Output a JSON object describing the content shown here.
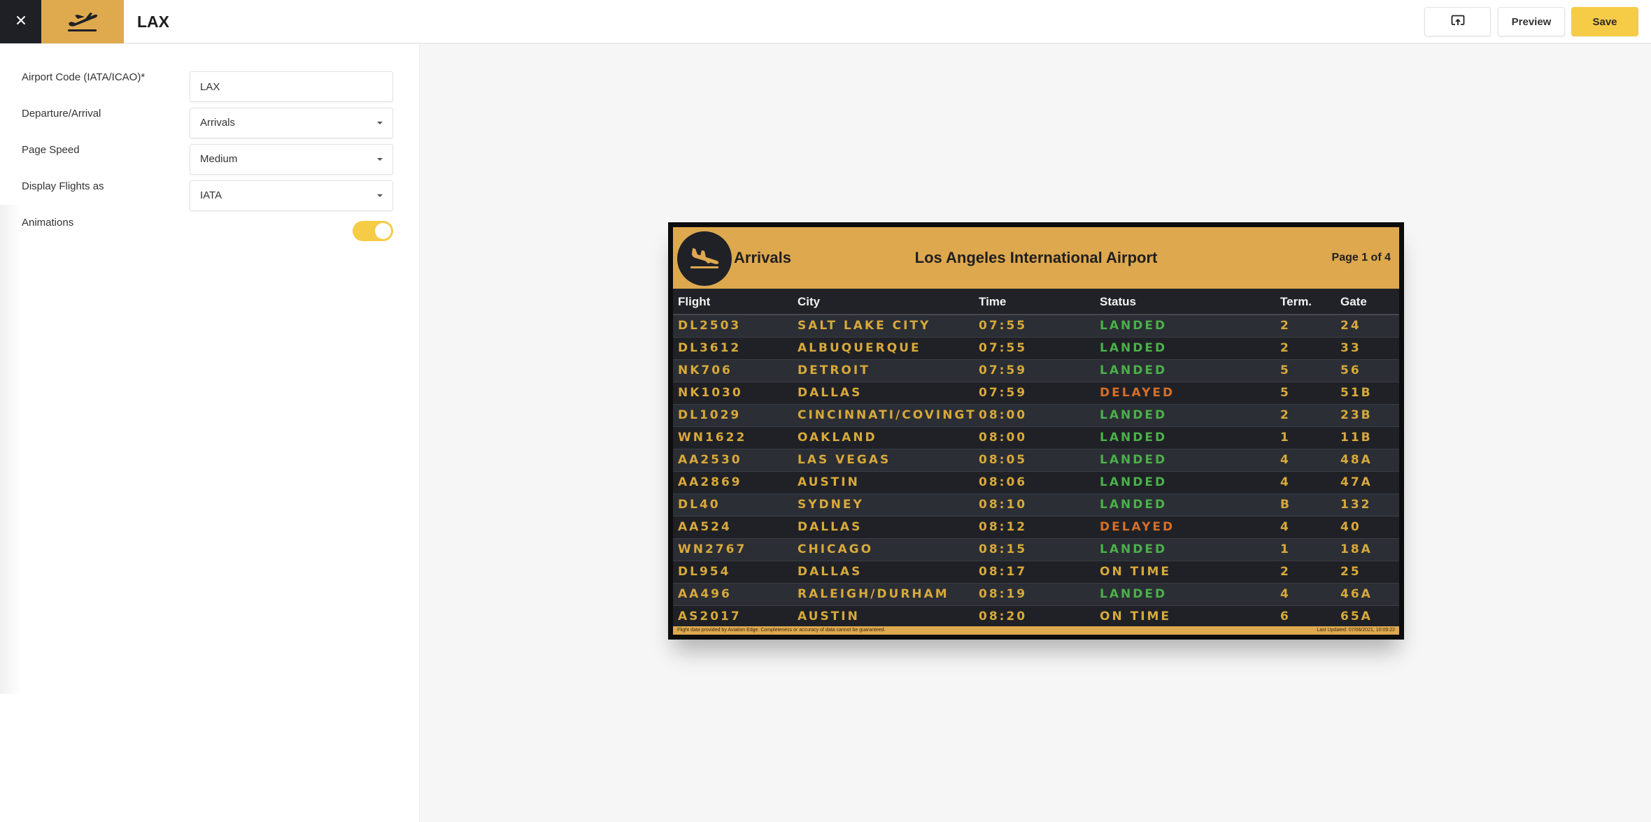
{
  "topbar": {
    "title": "LAX",
    "close_icon": "close-icon",
    "app_icon": "airplane-departure-icon",
    "cast_icon": "cast-upload-icon",
    "preview_label": "Preview",
    "save_label": "Save"
  },
  "form": {
    "airport_code": {
      "label": "Airport Code (IATA/ICAO)*",
      "value": "LAX"
    },
    "direction": {
      "label": "Departure/Arrival",
      "value": "Arrivals"
    },
    "page_speed": {
      "label": "Page Speed",
      "value": "Medium"
    },
    "display_as": {
      "label": "Display Flights as",
      "value": "IATA"
    },
    "animations": {
      "label": "Animations",
      "value": true
    }
  },
  "board": {
    "logo_icon": "airplane-arrival-icon",
    "mode": "Arrivals",
    "airport_name": "Los Angeles International Airport",
    "page_indicator": "Page 1 of 4",
    "columns": {
      "flight": "Flight",
      "city": "City",
      "time": "Time",
      "status": "Status",
      "term": "Term.",
      "gate": "Gate"
    },
    "flights": [
      {
        "flight": "DL2503",
        "city": "SALT LAKE CITY",
        "time": "07:55",
        "status": "LANDED",
        "term": "2",
        "gate": "24"
      },
      {
        "flight": "DL3612",
        "city": "ALBUQUERQUE",
        "time": "07:55",
        "status": "LANDED",
        "term": "2",
        "gate": "33"
      },
      {
        "flight": "NK706",
        "city": "DETROIT",
        "time": "07:59",
        "status": "LANDED",
        "term": "5",
        "gate": "56"
      },
      {
        "flight": "NK1030",
        "city": "DALLAS",
        "time": "07:59",
        "status": "DELAYED",
        "term": "5",
        "gate": "51B"
      },
      {
        "flight": "DL1029",
        "city": "CINCINNATI/COVINGT",
        "time": "08:00",
        "status": "LANDED",
        "term": "2",
        "gate": "23B"
      },
      {
        "flight": "WN1622",
        "city": "OAKLAND",
        "time": "08:00",
        "status": "LANDED",
        "term": "1",
        "gate": "11B"
      },
      {
        "flight": "AA2530",
        "city": "LAS VEGAS",
        "time": "08:05",
        "status": "LANDED",
        "term": "4",
        "gate": "48A"
      },
      {
        "flight": "AA2869",
        "city": "AUSTIN",
        "time": "08:06",
        "status": "LANDED",
        "term": "4",
        "gate": "47A"
      },
      {
        "flight": "DL40",
        "city": "SYDNEY",
        "time": "08:10",
        "status": "LANDED",
        "term": "B",
        "gate": "132"
      },
      {
        "flight": "AA524",
        "city": "DALLAS",
        "time": "08:12",
        "status": "DELAYED",
        "term": "4",
        "gate": "40"
      },
      {
        "flight": "WN2767",
        "city": "CHICAGO",
        "time": "08:15",
        "status": "LANDED",
        "term": "1",
        "gate": "18A"
      },
      {
        "flight": "DL954",
        "city": "DALLAS",
        "time": "08:17",
        "status": "ON TIME",
        "term": "2",
        "gate": "25"
      },
      {
        "flight": "AA496",
        "city": "RALEIGH/DURHAM",
        "time": "08:19",
        "status": "LANDED",
        "term": "4",
        "gate": "46A"
      },
      {
        "flight": "AS2017",
        "city": "AUSTIN",
        "time": "08:20",
        "status": "ON TIME",
        "term": "6",
        "gate": "65A"
      }
    ],
    "footer_disclaimer": "Flight data provided by Aviation Edge. Completeness or accuracy of data cannot be guaranteed.",
    "footer_updated": "Last Updated: 07/06/2021, 10:09:22",
    "status_colors": {
      "LANDED": "#4bb04a",
      "DELAYED": "#d66f26",
      "ON TIME": "#d8a93a"
    }
  },
  "colors": {
    "accent_gold": "#dea84f",
    "save_yellow": "#f6cb45",
    "dark": "#1e2026",
    "board_text": "#d8a93a"
  }
}
